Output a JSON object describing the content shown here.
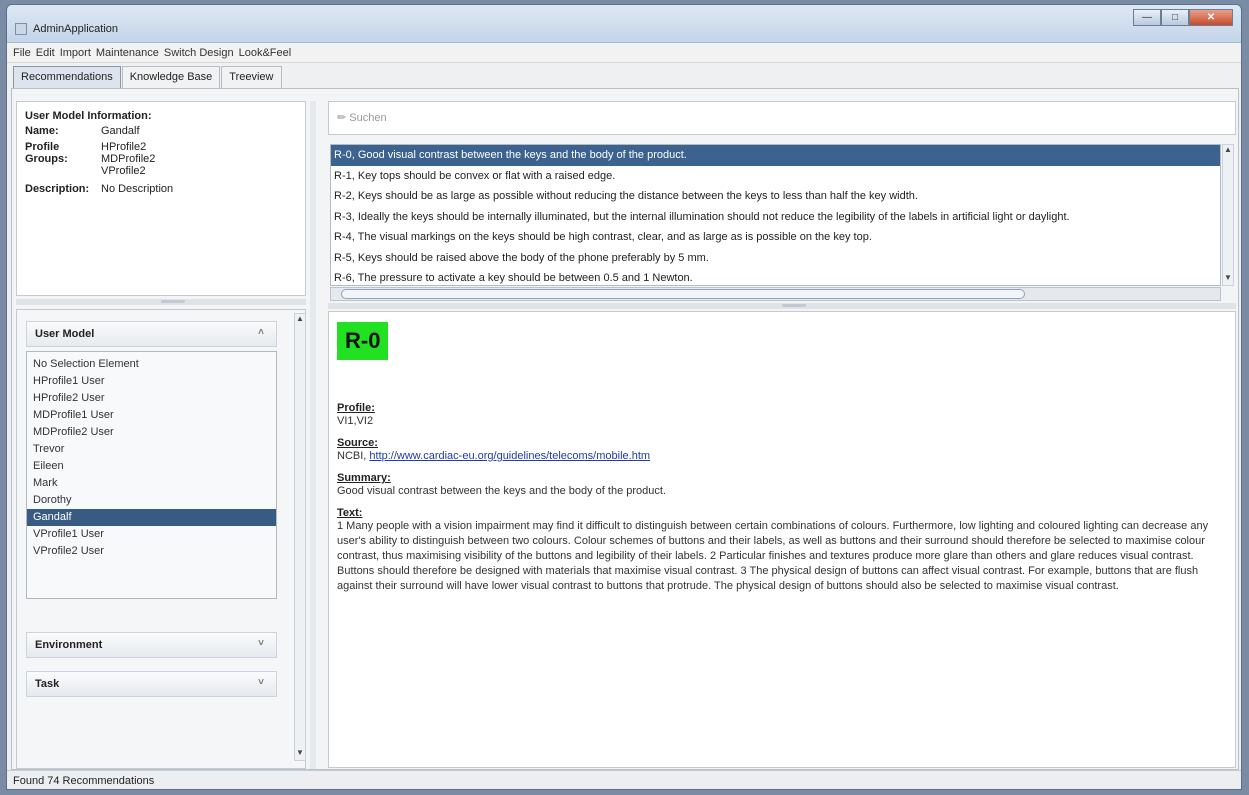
{
  "window": {
    "title": "AdminApplication"
  },
  "menu": [
    "File",
    "Edit",
    "Import",
    "Maintenance",
    "Switch Design",
    "Look&Feel"
  ],
  "tabs": [
    "Recommendations",
    "Knowledge Base",
    "Treeview"
  ],
  "user_model_info": {
    "title": "User Model Information:",
    "name_label": "Name:",
    "name_value": "Gandalf",
    "profile_label1": "Profile",
    "profile_label2": "Groups:",
    "profile_groups": [
      "HProfile2",
      "MDProfile2",
      "VProfile2"
    ],
    "description_label": "Description:",
    "description_value": "No Description"
  },
  "accordion": {
    "user_model_header": "User Model",
    "environment_header": "Environment",
    "task_header": "Task",
    "users": [
      "No Selection Element",
      "HProfile1 User",
      "HProfile2 User",
      "MDProfile1 User",
      "MDProfile2 User",
      "Trevor",
      "Eileen",
      "Mark",
      "Dorothy",
      "Gandalf",
      "VProfile1 User",
      "VProfile2 User"
    ],
    "selected_user": "Gandalf"
  },
  "search": {
    "placeholder": "Suchen"
  },
  "recommendations": [
    "R-0, Good visual contrast between the keys and the body of the product.",
    "R-1, Key tops should be convex or flat with a raised edge.",
    "R-2, Keys should be as large as possible without reducing the distance between the keys to less than half the key width.",
    "R-3, Ideally the keys should be internally illuminated, but the internal illumination should not reduce the legibility of the labels in artificial light or daylight.",
    "R-4, The visual markings on the keys should be high contrast, clear, and as large as is possible on the key top.",
    "R-5, Keys should be raised above the body of the phone preferably by 5 mm.",
    "R-6, The pressure to activate a key should be between 0.5 and 1 Newton."
  ],
  "detail": {
    "id": "R-0",
    "profile_label": "Profile:",
    "profile_value": "VI1,VI2",
    "source_label": "Source:",
    "source_prefix": "NCBI,",
    "source_link": "http://www.cardiac-eu.org/guidelines/telecoms/mobile.htm",
    "summary_label": "Summary:",
    "summary_value": "Good visual contrast between the keys and the body of the product.",
    "text_label": "Text:",
    "text_value": "1 Many people with a vision impairment may find it difficult to distinguish between certain combinations of colours. Furthermore, low lighting and coloured lighting can decrease any user's ability to distinguish between two colours. Colour schemes of buttons and their labels, as well as buttons and their surround should therefore be selected to maximise colour contrast, thus maximising visibility of the buttons and legibility of their labels. 2 Particular finishes and textures produce more glare than others and glare reduces visual contrast. Buttons should therefore be designed with materials that maximise visual contrast. 3 The physical design of buttons can affect visual contrast. For example, buttons that are flush against their surround will have lower visual contrast to buttons that protrude. The physical design of buttons should also be selected to maximise visual contrast."
  },
  "status": "Found 74 Recommendations"
}
